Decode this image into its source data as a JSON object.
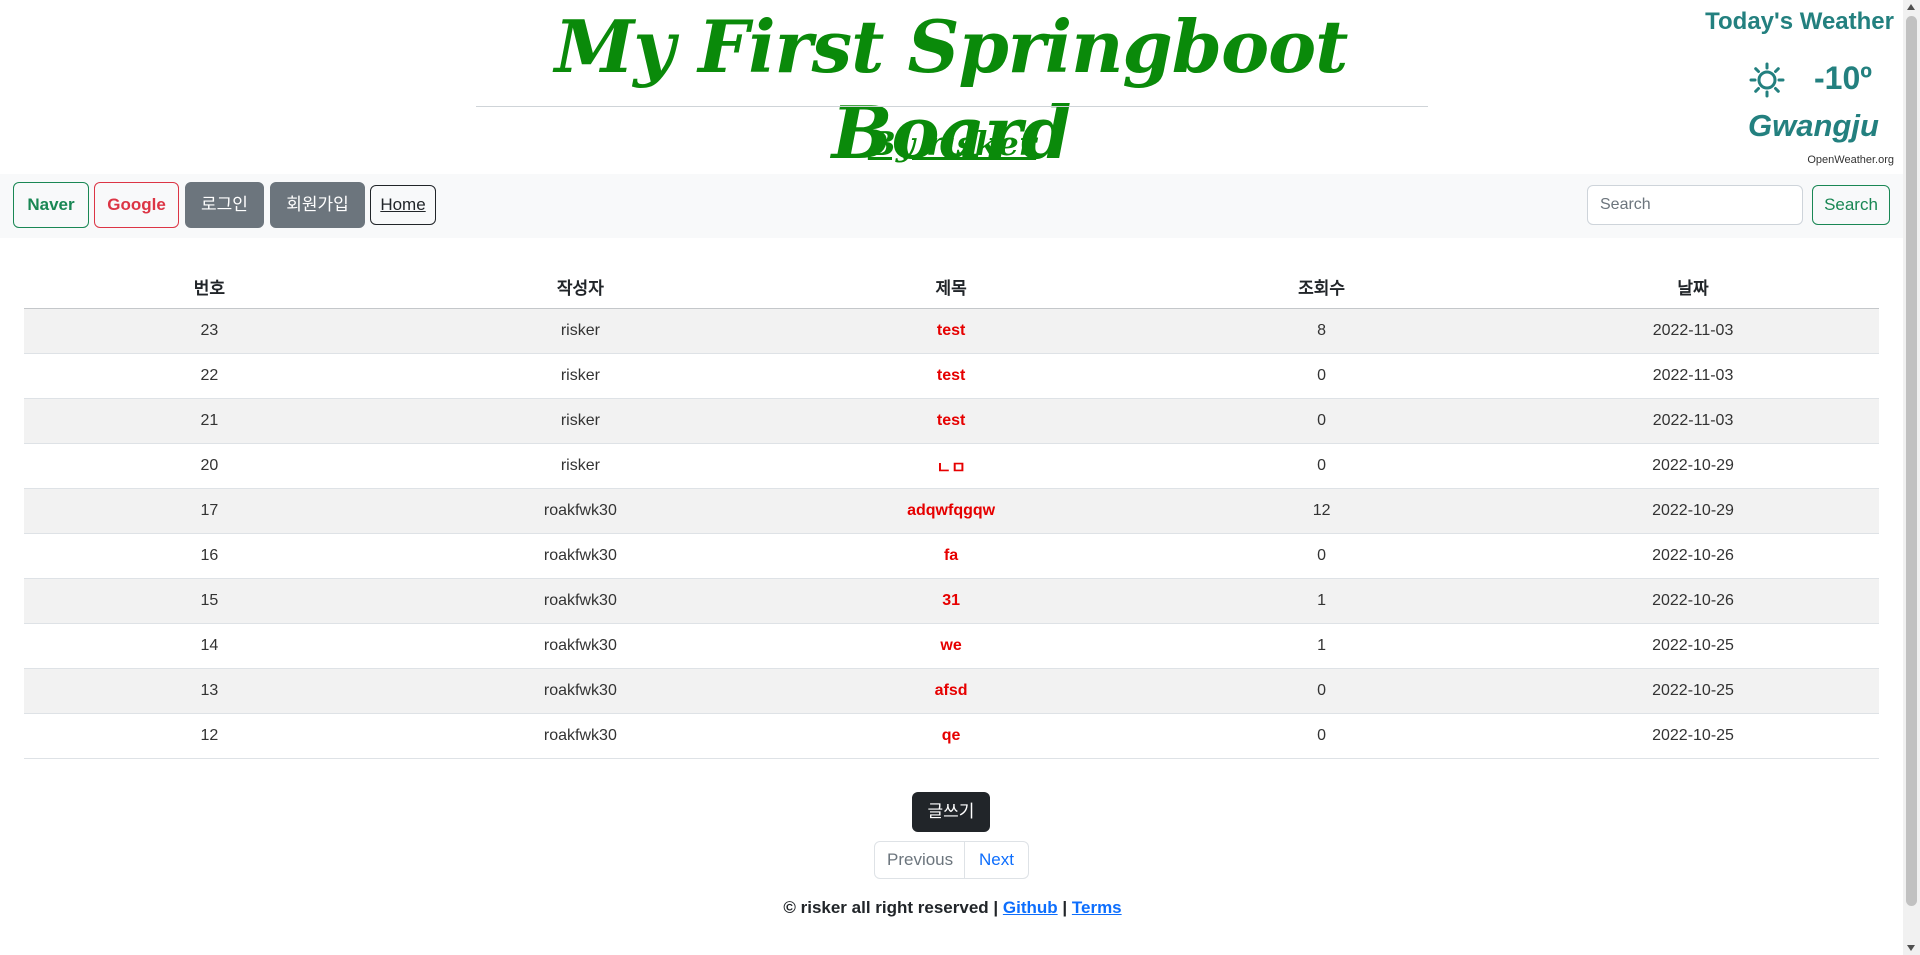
{
  "header": {
    "title": "My First Springboot Board",
    "byline": "By risker"
  },
  "weather": {
    "title": "Today's Weather",
    "icon": "sun-icon",
    "temperature": "-10º",
    "city": "Gwangju",
    "credit": "OpenWeather.org",
    "accent_color": "#23807f"
  },
  "nav": {
    "naver": "Naver",
    "google": "Google",
    "login": "로그인",
    "signup": "회원가입",
    "home": "Home",
    "search_placeholder": "Search",
    "search_button": "Search"
  },
  "table": {
    "headers": [
      "번호",
      "작성자",
      "제목",
      "조회수",
      "날짜"
    ],
    "rows": [
      {
        "id": "23",
        "author": "risker",
        "title": "test",
        "views": "8",
        "date": "2022-11-03"
      },
      {
        "id": "22",
        "author": "risker",
        "title": "test",
        "views": "0",
        "date": "2022-11-03"
      },
      {
        "id": "21",
        "author": "risker",
        "title": "test",
        "views": "0",
        "date": "2022-11-03"
      },
      {
        "id": "20",
        "author": "risker",
        "title": "ㄴㅁ",
        "views": "0",
        "date": "2022-10-29"
      },
      {
        "id": "17",
        "author": "roakfwk30",
        "title": "adqwfqgqw",
        "views": "12",
        "date": "2022-10-29"
      },
      {
        "id": "16",
        "author": "roakfwk30",
        "title": "fa",
        "views": "0",
        "date": "2022-10-26"
      },
      {
        "id": "15",
        "author": "roakfwk30",
        "title": "31",
        "views": "1",
        "date": "2022-10-26"
      },
      {
        "id": "14",
        "author": "roakfwk30",
        "title": "we",
        "views": "1",
        "date": "2022-10-25"
      },
      {
        "id": "13",
        "author": "roakfwk30",
        "title": "afsd",
        "views": "0",
        "date": "2022-10-25"
      },
      {
        "id": "12",
        "author": "roakfwk30",
        "title": "qe",
        "views": "0",
        "date": "2022-10-25"
      }
    ]
  },
  "actions": {
    "write": "글쓰기"
  },
  "pagination": {
    "previous": "Previous",
    "next": "Next"
  },
  "footer": {
    "copyright": "© risker all right reserved |",
    "github": "Github",
    "separator": "|",
    "terms": "Terms"
  },
  "colors": {
    "brand_green": "#0a8a0a",
    "title_link_red": "#e60000"
  }
}
